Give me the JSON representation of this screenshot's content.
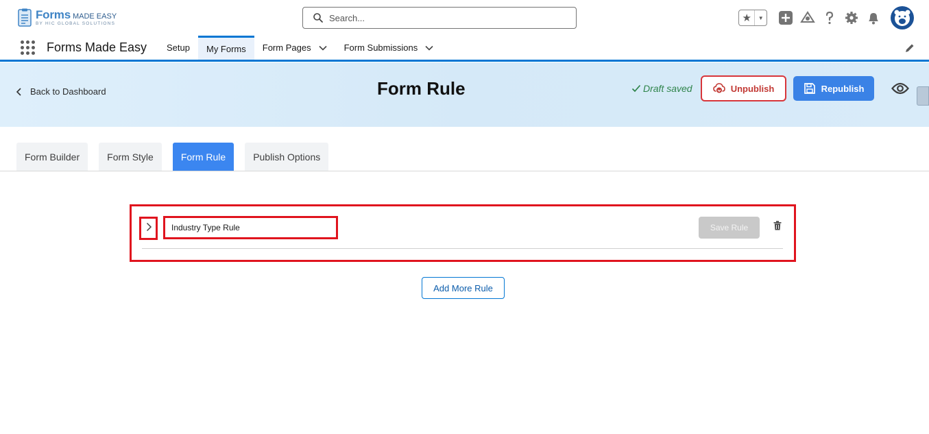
{
  "header": {
    "logo": {
      "primary": "Forms",
      "secondary": "MADE EASY",
      "tagline": "BY HIC GLOBAL SOLUTIONS"
    },
    "search": {
      "placeholder": "Search..."
    },
    "icons": [
      "favorites-star-icon",
      "favorites-dropdown-icon",
      "add-icon",
      "trailhead-icon",
      "help-icon",
      "settings-icon",
      "notifications-icon",
      "avatar"
    ]
  },
  "app_nav": {
    "app_name": "Forms Made Easy",
    "items": [
      {
        "label": "Setup",
        "active": false,
        "has_dropdown": false
      },
      {
        "label": "My Forms",
        "active": true,
        "has_dropdown": false
      },
      {
        "label": "Form Pages",
        "active": false,
        "has_dropdown": true
      },
      {
        "label": "Form Submissions",
        "active": false,
        "has_dropdown": true
      }
    ]
  },
  "banner": {
    "back_label": "Back to Dashboard",
    "title": "Form Rule",
    "draft_status": "Draft saved",
    "unpublish_label": "Unpublish",
    "republish_label": "Republish"
  },
  "tabs": [
    {
      "label": "Form Builder",
      "active": false
    },
    {
      "label": "Form Style",
      "active": false
    },
    {
      "label": "Form Rule",
      "active": true
    },
    {
      "label": "Publish Options",
      "active": false
    }
  ],
  "rule": {
    "name_value": "Industry Type Rule",
    "save_label": "Save Rule"
  },
  "add_rule_label": "Add More Rule",
  "colors": {
    "brand_blue": "#0176d3",
    "republish_blue": "#3a82e6",
    "unpublish_red": "#c23934",
    "highlight_red": "#e0141e",
    "draft_green": "#2e844a"
  }
}
